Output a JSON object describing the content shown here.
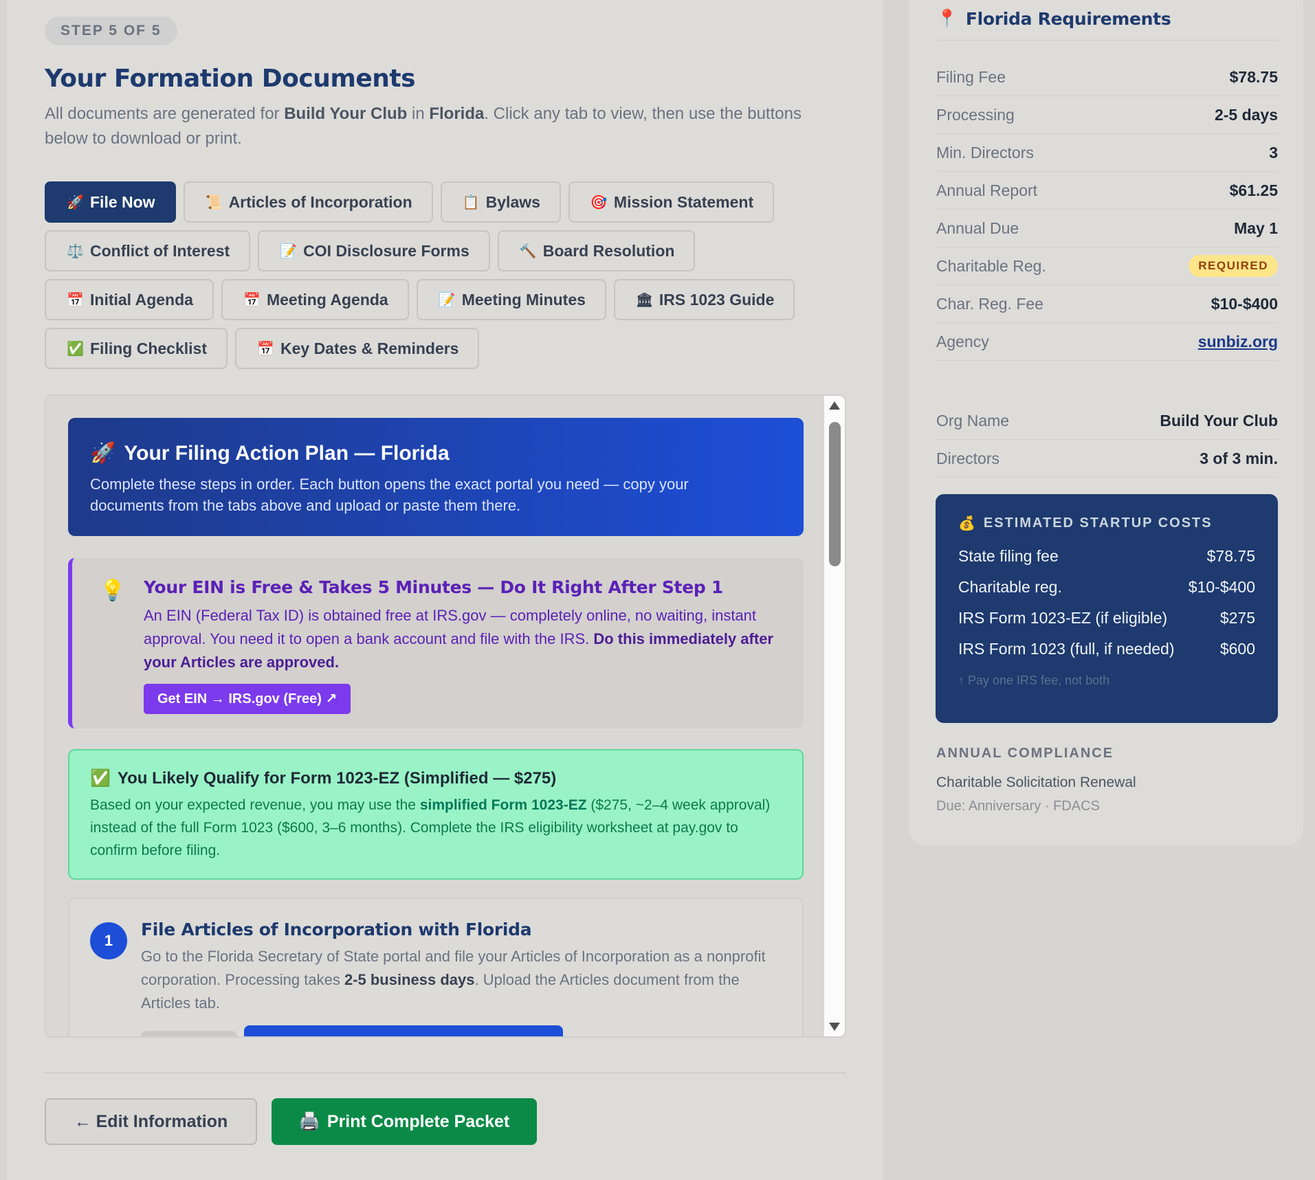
{
  "step_badge": "STEP 5 OF 5",
  "page_title": "Your Formation Documents",
  "intro": {
    "prefix": "All documents are generated for ",
    "org": "Build Your Club",
    "mid": " in ",
    "state": "Florida",
    "suffix": ". Click any tab to view, then use the buttons below to download or print."
  },
  "tabs": [
    {
      "icon": "🚀",
      "label": "File Now",
      "active": true
    },
    {
      "icon": "📜",
      "label": "Articles of Incorporation"
    },
    {
      "icon": "📋",
      "label": "Bylaws"
    },
    {
      "icon": "🎯",
      "label": "Mission Statement"
    },
    {
      "icon": "⚖️",
      "label": "Conflict of Interest"
    },
    {
      "icon": "📝",
      "label": "COI Disclosure Forms"
    },
    {
      "icon": "🔨",
      "label": "Board Resolution"
    },
    {
      "icon": "📅",
      "label": "Initial Agenda"
    },
    {
      "icon": "📅",
      "label": "Meeting Agenda"
    },
    {
      "icon": "📝",
      "label": "Meeting Minutes"
    },
    {
      "icon": "🏛",
      "label": "IRS 1023 Guide"
    },
    {
      "icon": "✅",
      "label": "Filing Checklist"
    },
    {
      "icon": "📅",
      "label": "Key Dates & Reminders"
    }
  ],
  "plan": {
    "icon": "🚀",
    "title": "Your Filing Action Plan — Florida",
    "text": "Complete these steps in order. Each button opens the exact portal you need — copy your documents from the tabs above and upload or paste them there."
  },
  "ein": {
    "icon": "💡",
    "title": "Your EIN is Free & Takes 5 Minutes — Do It Right After Step 1",
    "text": "An EIN (Federal Tax ID) is obtained free at IRS.gov — completely online, no waiting, instant approval. You need it to open a bank account and file with the IRS. ",
    "text_bold": "Do this immediately after your Articles are approved.",
    "button": "Get EIN → IRS.gov (Free) ↗"
  },
  "qualify": {
    "icon": "✅",
    "title": "You Likely Qualify for Form 1023-EZ (Simplified — $275)",
    "prefix": "Based on your expected revenue, you may use the ",
    "bold": "simplified Form 1023-EZ",
    "suffix": " ($275, ~2–4 week approval) instead of the full Form 1023 ($600, 3–6 months). Complete the IRS eligibility worksheet at pay.gov to confirm before filing."
  },
  "step1": {
    "number": "1",
    "title": "File Articles of Incorporation with Florida",
    "prefix": "Go to the Florida Secretary of State portal and file your Articles of Incorporation as a nonprofit corporation. Processing takes ",
    "bold": "2-5 business days",
    "suffix": ". Upload the Articles document from the Articles tab."
  },
  "buttons": {
    "edit": "← Edit Information",
    "print_icon": "🖨️",
    "print": "Print Complete Packet"
  },
  "requirements": {
    "icon": "📍",
    "title": "Florida Requirements",
    "rows": [
      {
        "k": "Filing Fee",
        "v": "$78.75"
      },
      {
        "k": "Processing",
        "v": "2-5 days"
      },
      {
        "k": "Min. Directors",
        "v": "3"
      },
      {
        "k": "Annual Report",
        "v": "$61.25"
      },
      {
        "k": "Annual Due",
        "v": "May 1"
      },
      {
        "k": "Charitable Reg.",
        "v": "REQUIRED"
      },
      {
        "k": "Char. Reg. Fee",
        "v": "$10-$400"
      },
      {
        "k": "Agency",
        "v": "sunbiz.org"
      }
    ]
  },
  "org": {
    "rows": [
      {
        "k": "Org Name",
        "v": "Build Your Club"
      },
      {
        "k": "Directors",
        "v": "3 of 3 min."
      }
    ]
  },
  "costs": {
    "icon": "💰",
    "title": "ESTIMATED STARTUP COSTS",
    "rows": [
      {
        "k": "State filing fee",
        "v": "$78.75"
      },
      {
        "k": "Charitable reg.",
        "v": "$10-$400"
      },
      {
        "k": "IRS Form 1023-EZ (if eligible)",
        "v": "$275"
      },
      {
        "k": "IRS Form 1023 (full, if needed)",
        "v": "$600"
      }
    ],
    "note": "↑ Pay one IRS fee, not both"
  },
  "compliance": {
    "title": "ANNUAL COMPLIANCE",
    "item": "Charitable Solicitation Renewal",
    "due": "Due: Anniversary · FDACS"
  }
}
